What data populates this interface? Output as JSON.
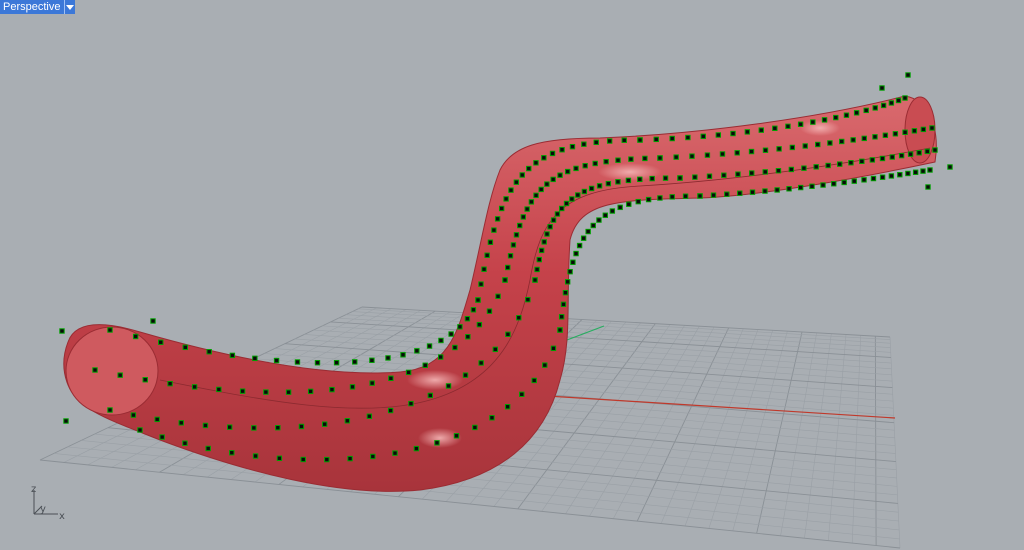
{
  "viewport": {
    "title": "Perspective",
    "menu_icon": "triangle-down-icon",
    "background_color": "#a9aeb3"
  },
  "scene": {
    "grid_color": "#9aa0a6",
    "grid_major_color": "#8a9096",
    "x_axis_color": "#c0392b",
    "y_axis_color": "#27ae60",
    "surface_color": "#c8444a",
    "control_point_color": "#00a000"
  },
  "axis_gizmo": {
    "z_label": "z",
    "y_label": "y",
    "x_label": "x"
  }
}
